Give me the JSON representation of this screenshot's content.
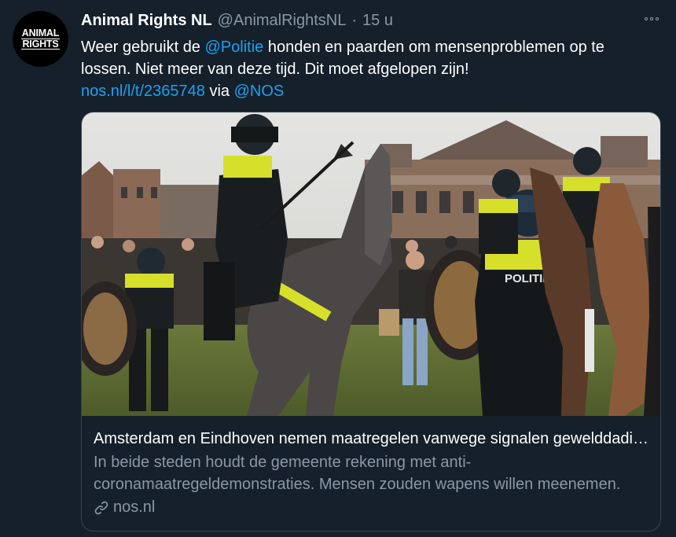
{
  "account": {
    "avatar_logo_line1": "ANIMAL",
    "avatar_logo_line2": "RIGHTS",
    "display_name": "Animal Rights NL",
    "handle": "@AnimalRightsNL",
    "separator": "·",
    "time": "15 u"
  },
  "tweet": {
    "text_part1": "Weer gebruikt de ",
    "mention_politie": "@Politie",
    "text_part2": " honden en paarden om mensenproblemen op te lossen. Niet meer van deze tijd. Dit moet afgelopen zijn!",
    "link_url": "nos.nl/l/t/2365748",
    "via_text": " via ",
    "mention_nos": "@NOS"
  },
  "card": {
    "image_vest_text": "POLITIE",
    "title": "Amsterdam en Eindhoven nemen maatregelen vanwege signalen gewelddadige demonstraties",
    "description": "In beide steden houdt de gemeente rekening met anti-coronamaatregeldemonstraties. Mensen zouden wapens willen meenemen.",
    "source": "nos.nl"
  },
  "icons": {
    "more": "more-horizontal-icon",
    "link": "link-icon"
  },
  "colors": {
    "background": "#15202b",
    "link": "#1da1f2",
    "secondary_text": "#8899a6",
    "border": "#38444d",
    "vest_yellow": "#d6e02a"
  }
}
